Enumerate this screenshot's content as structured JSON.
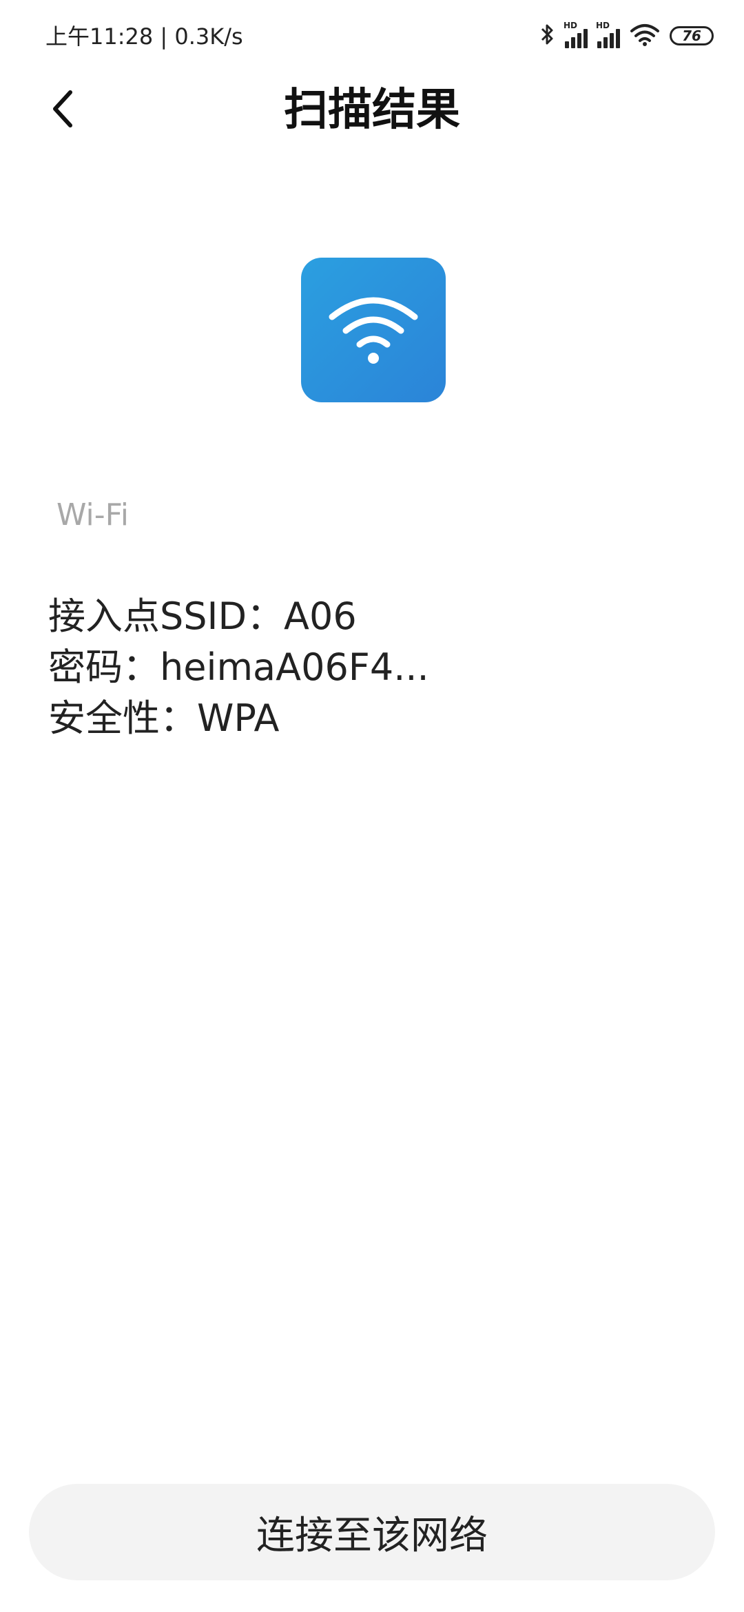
{
  "status_bar": {
    "time": "上午11:28",
    "speed": "0.3K/s",
    "hd_label": "HD",
    "battery": "76",
    "icons": [
      "bluetooth-icon",
      "signal-hd-icon",
      "signal-hd-icon",
      "wifi-icon",
      "battery-icon"
    ]
  },
  "header": {
    "back_icon": "chevron-left-icon",
    "title": "扫描结果"
  },
  "result": {
    "icon": "wifi-icon",
    "type_label": "Wi-Fi",
    "ssid_line": "接入点SSID：A06",
    "password_line": "密码：heimaA06F4...",
    "security_line": "安全性：WPA"
  },
  "actions": {
    "connect_label": "连接至该网络"
  },
  "colors": {
    "accent": "#2b8fdc",
    "button_bg": "#f3f3f3",
    "secondary_text": "#a8a8a8"
  }
}
